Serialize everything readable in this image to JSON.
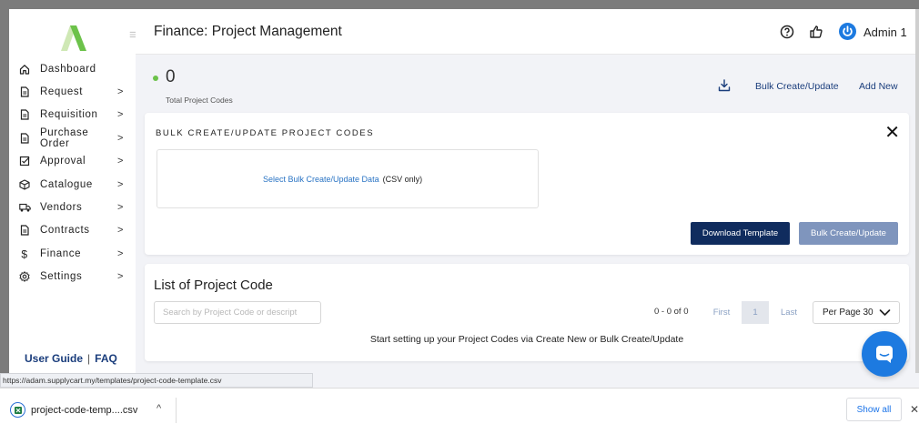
{
  "header": {
    "title": "Finance: Project Management",
    "user": "Admin 1"
  },
  "sidebar": {
    "items": [
      {
        "label": "Dashboard",
        "icon": "home-icon",
        "has_children": false
      },
      {
        "label": "Request",
        "icon": "document-icon",
        "has_children": true
      },
      {
        "label": "Requisition",
        "icon": "document-icon",
        "has_children": true
      },
      {
        "label": "Purchase Order",
        "icon": "document-icon",
        "has_children": true
      },
      {
        "label": "Approval",
        "icon": "checkbox-icon",
        "has_children": true
      },
      {
        "label": "Catalogue",
        "icon": "box-icon",
        "has_children": true
      },
      {
        "label": "Vendors",
        "icon": "truck-icon",
        "has_children": true
      },
      {
        "label": "Contracts",
        "icon": "document-icon",
        "has_children": true
      },
      {
        "label": "Finance",
        "icon": "dollar-icon",
        "has_children": true
      },
      {
        "label": "Settings",
        "icon": "gear-icon",
        "has_children": true
      }
    ],
    "chevron": ">",
    "user_guide": "User Guide",
    "separator": "|",
    "faq": "FAQ"
  },
  "summary": {
    "count": "0",
    "count_label": "Total Project Codes",
    "bulk_link": "Bulk Create/Update",
    "add_link": "Add New"
  },
  "bulk": {
    "title": "BULK CREATE/UPDATE PROJECT CODES",
    "close": "✕",
    "upload_link": "Select Bulk Create/Update Data",
    "upload_note": "(CSV only)",
    "download_template": "Download Template",
    "submit": "Bulk Create/Update"
  },
  "list": {
    "title": "List of Project Code",
    "search_placeholder": "Search by Project Code or descript",
    "range": "0 - 0 of 0",
    "first": "First",
    "current_page": "1",
    "last": "Last",
    "per_page": "Per Page 30",
    "empty_message": "Start setting up your Project Codes via Create New or Bulk Create/Update"
  },
  "status_url": "https://adam.supplycart.my/templates/project-code-template.csv",
  "downloads": {
    "file_name": "project-code-temp....csv",
    "caret": "^",
    "show_all": "Show all",
    "close": "✕"
  },
  "colors": {
    "primary": "#102c5e",
    "muted_button": "#7f95bd",
    "link": "#2a74c4",
    "accent_green": "#6cc24a",
    "chat": "#1d7ae0"
  }
}
